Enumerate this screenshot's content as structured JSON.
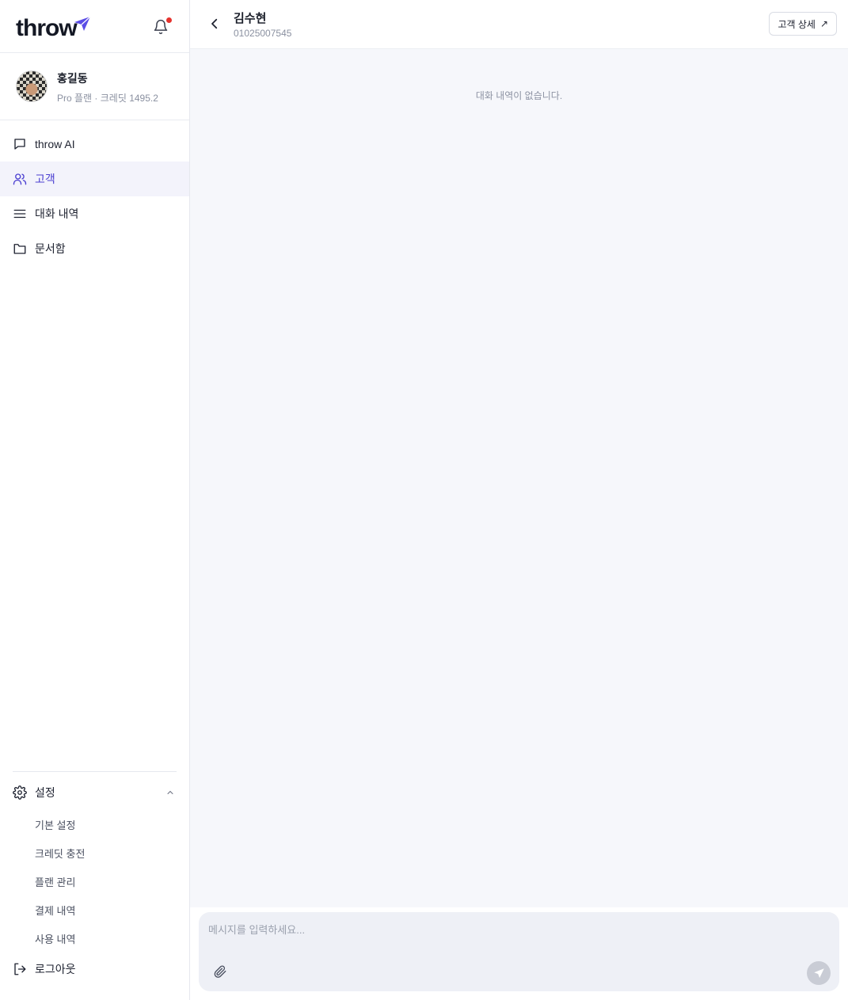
{
  "brand": {
    "logo_text": "throw",
    "accent": "#5b4de6"
  },
  "notifications": {
    "has_unread": true,
    "dot_color": "#e5322d"
  },
  "profile": {
    "name": "홍길동",
    "plan_credit": "Pro 플랜 · 크레딧 1495.2"
  },
  "nav": {
    "items": [
      {
        "label": "throw AI",
        "icon": "chat-bubble-icon",
        "active": false
      },
      {
        "label": "고객",
        "icon": "users-icon",
        "active": true
      },
      {
        "label": "대화 내역",
        "icon": "list-icon",
        "active": false
      },
      {
        "label": "문서함",
        "icon": "folder-icon",
        "active": false
      }
    ],
    "active_color": "#4b3fd1"
  },
  "settings": {
    "label": "설정",
    "expanded": true,
    "items": [
      "기본 설정",
      "크레딧 충전",
      "플랜 관리",
      "결제 내역",
      "사용 내역"
    ]
  },
  "logout_label": "로그아웃",
  "header": {
    "customer_name": "김수현",
    "customer_phone": "01025007545",
    "detail_button": "고객 상세",
    "detail_arrow": "↗"
  },
  "conversation": {
    "empty_text": "대화 내역이 없습니다."
  },
  "composer": {
    "placeholder": "메시지를 입력하세요...",
    "value": ""
  }
}
